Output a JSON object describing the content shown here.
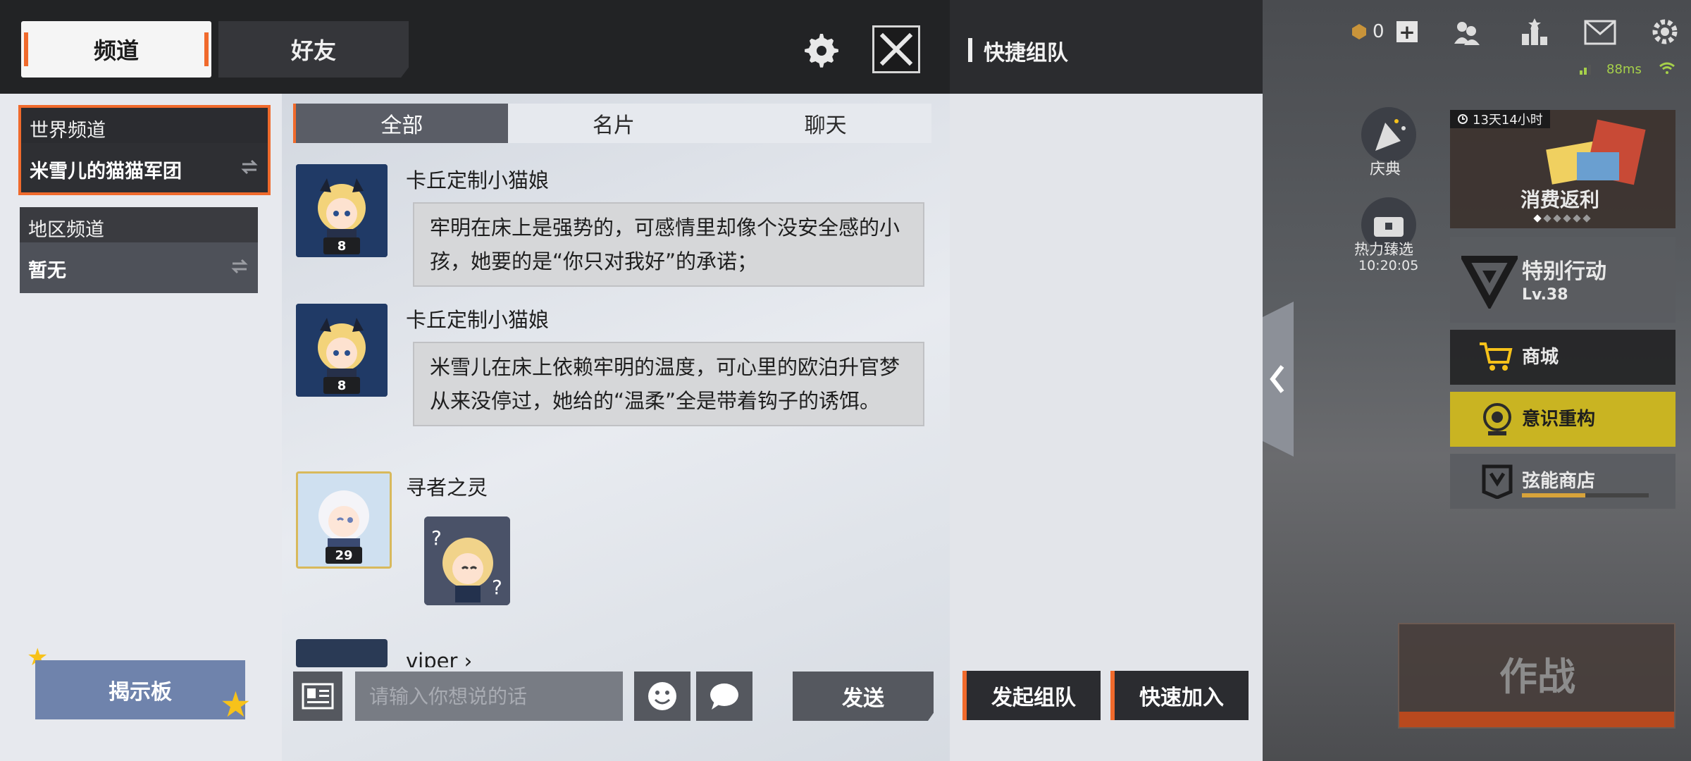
{
  "chat": {
    "tabs": [
      "频道",
      "好友"
    ],
    "channels": [
      {
        "title": "世界频道",
        "name": "米雪儿的猫猫军团"
      },
      {
        "title": "地区频道",
        "name": "暂无"
      }
    ],
    "bulletin_label": "揭示板",
    "filter_tabs": [
      "全部",
      "名片",
      "聊天"
    ],
    "messages": [
      {
        "sender": "卡丘定制小猫娘",
        "level": "8",
        "text": "牢明在床上是强势的，可感情里却像个没安全感的小孩，她要的是“你只对我好”的承诺；"
      },
      {
        "sender": "卡丘定制小猫娘",
        "level": "8",
        "text": "米雪儿在床上依赖牢明的温度，可心里的欧泊升官梦从来没停过，她给的“温柔”全是带着钩子的诱饵。"
      },
      {
        "sender": "寻者之灵",
        "level": "29",
        "sticker": true
      },
      {
        "sender": "viper ›",
        "level": ""
      }
    ],
    "input_placeholder": "请输入你想说的话",
    "send_label": "发送"
  },
  "team": {
    "title": "快捷组队",
    "create_label": "发起组队",
    "join_label": "快速加入"
  },
  "game": {
    "currency": "0",
    "ping": "88ms",
    "event_timer": "13天14小时",
    "celebration_label": "庆典",
    "hot_pick_label": "热力臻选",
    "hot_pick_timer": "10:20:05",
    "rebate_label": "消费返利",
    "special_op_label": "特别行动",
    "special_op_level": "Lv.38",
    "shop_label": "商城",
    "rebuild_label": "意识重构",
    "string_shop_label": "弦能商店",
    "battle_label": "作战"
  },
  "colors": {
    "accent": "#f06a2c",
    "bulletin": "#6f83ac",
    "gold": "#f7c21a"
  }
}
